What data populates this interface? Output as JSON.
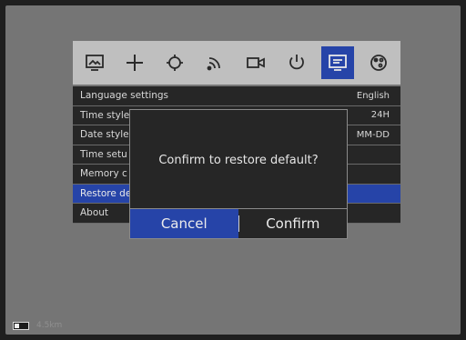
{
  "toolbar": {
    "icons": [
      {
        "name": "image-settings-icon",
        "active": false
      },
      {
        "name": "crosshair-icon",
        "active": false
      },
      {
        "name": "calibration-icon",
        "active": false
      },
      {
        "name": "wifi-icon",
        "active": false
      },
      {
        "name": "video-record-icon",
        "active": false
      },
      {
        "name": "power-icon",
        "active": false
      },
      {
        "name": "display-settings-icon",
        "active": true
      },
      {
        "name": "palette-icon",
        "active": false
      }
    ]
  },
  "menu": {
    "items": [
      {
        "label": "Language settings",
        "value": "English"
      },
      {
        "label": "Time style",
        "value": "24H"
      },
      {
        "label": "Date style",
        "value": "MM-DD"
      },
      {
        "label": "Time setu",
        "value": ""
      },
      {
        "label": "Memory c",
        "value": ""
      },
      {
        "label": "Restore de",
        "value": "",
        "selected": true
      },
      {
        "label": "About",
        "value": ""
      }
    ]
  },
  "dialog": {
    "message": "Confirm to restore default?",
    "cancel_label": "Cancel",
    "confirm_label": "Confirm"
  },
  "status": {
    "battery_icon": "battery-icon",
    "zoom_label": "4.5km"
  },
  "colors": {
    "accent": "#2644a8",
    "panel": "#262626",
    "toolbar": "#bfbfbf"
  }
}
